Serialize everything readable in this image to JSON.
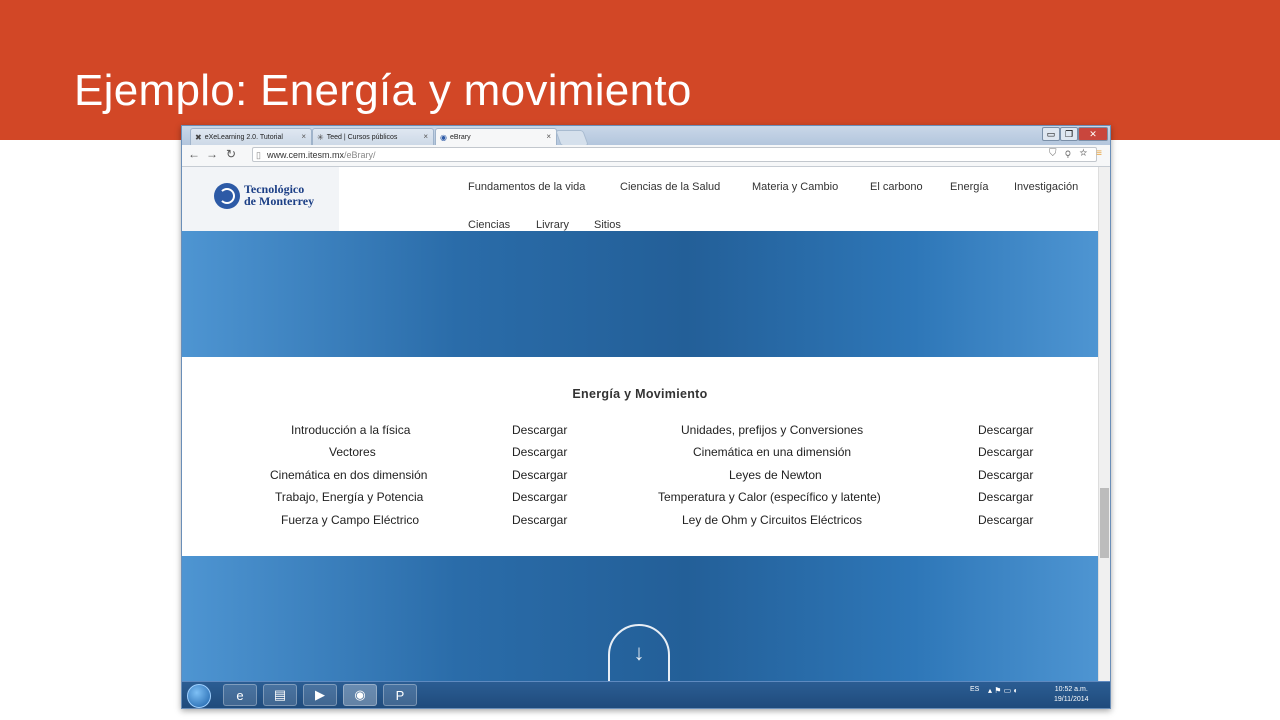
{
  "slide": {
    "title": "Ejemplo: Energía y movimiento"
  },
  "browser": {
    "tabs": [
      {
        "label": "eXeLearning 2.0. Tutorial",
        "icon": "exe-icon"
      },
      {
        "label": "Teed | Cursos públicos",
        "icon": "teed-icon"
      },
      {
        "label": "eBrary",
        "icon": "globe-icon",
        "active": true
      }
    ],
    "url_host": "www.cem.itesm.mx",
    "url_path": "/eBrary/"
  },
  "site": {
    "logo_line1": "Tecnológico",
    "logo_line2": "de Monterrey",
    "nav_row1": [
      "Fundamentos de la vida",
      "Ciencias de la Salud",
      "Materia y Cambio",
      "El carbono",
      "Energía",
      "Investigación"
    ],
    "nav_row2": [
      "Ciencias",
      "Livrary",
      "Sitios"
    ]
  },
  "content": {
    "title": "Energía y Movimiento",
    "rows": [
      {
        "left": "Introducción a la física",
        "left_action": "Descargar",
        "right": "Unidades, prefijos y Conversiones",
        "right_action": "Descargar"
      },
      {
        "left": "Vectores",
        "left_action": "Descargar",
        "right": "Cinemática en una dimensión",
        "right_action": "Descargar"
      },
      {
        "left": "Cinemática en dos dimensión",
        "left_action": "Descargar",
        "right": "Leyes de Newton",
        "right_action": "Descargar"
      },
      {
        "left": "Trabajo, Energía y Potencia",
        "left_action": "Descargar",
        "right": "Temperatura y Calor (específico y latente)",
        "right_action": "Descargar"
      },
      {
        "left": "Fuerza y Campo Eléctrico",
        "left_action": "Descargar",
        "right": "Ley de Ohm y Circuitos Eléctricos",
        "right_action": "Descargar"
      }
    ]
  },
  "taskbar": {
    "language": "ES",
    "time": "10:52 a.m.",
    "date": "19/11/2014"
  },
  "colors": {
    "slide_accent": "#d24726",
    "banner_blue": "#2a6ca9",
    "logo_blue": "#1c3f86"
  }
}
